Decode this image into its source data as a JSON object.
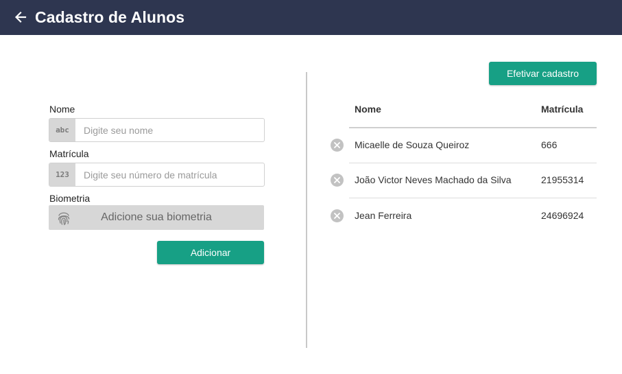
{
  "header": {
    "title": "Cadastro de Alunos",
    "back_icon": "arrow-left-icon",
    "background": "#2e3650"
  },
  "form": {
    "name_label": "Nome",
    "name_addon": "abc",
    "name_placeholder": "Digite seu nome",
    "name_value": "",
    "matricula_label": "Matrícula",
    "matricula_addon": "123",
    "matricula_placeholder": "Digite seu número de matrícula",
    "matricula_value": "",
    "biometria_label": "Biometria",
    "biometria_icon": "fingerprint-icon",
    "biometria_button": "Adicione sua biometria",
    "add_button": "Adicionar"
  },
  "list": {
    "submit_button": "Efetivar cadastro",
    "columns": [
      "Nome",
      "Matrícula"
    ],
    "rows": [
      {
        "name": "Micaelle de Souza Queiroz",
        "matricula": "666"
      },
      {
        "name": "João Victor Neves Machado da Silva",
        "matricula": "21955314"
      },
      {
        "name": "Jean Ferreira",
        "matricula": "24696924"
      }
    ],
    "remove_icon": "remove-circle-icon"
  },
  "colors": {
    "accent": "#17a085",
    "addon_bg": "#d7d7d7",
    "remove_icon": "#c2c2c2"
  }
}
